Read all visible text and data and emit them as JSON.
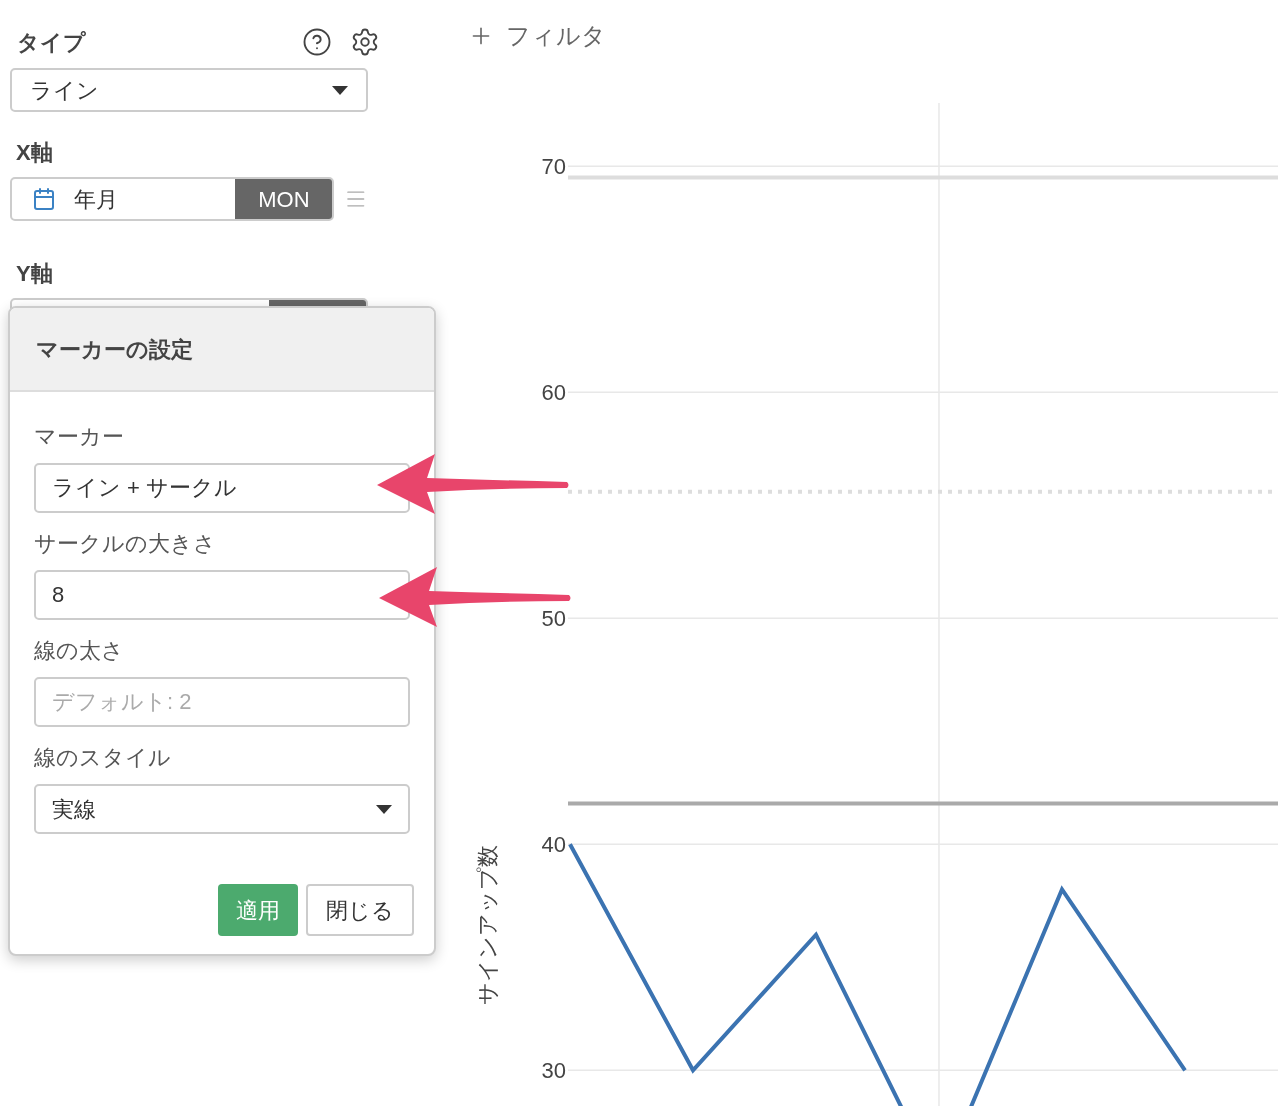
{
  "sidebar": {
    "type_label": "タイプ",
    "type_select": "ライン",
    "x_axis_label": "X軸",
    "x_field": {
      "value": "年月",
      "badge": "MON"
    },
    "y_axis_label": "Y軸"
  },
  "filter_button": "フィルタ",
  "marker_dialog": {
    "title": "マーカーの設定",
    "fields": [
      {
        "kind": "text",
        "label": "マーカー",
        "value": "ライン + サークル"
      },
      {
        "kind": "text",
        "label": "サークルの大きさ",
        "value": "8"
      },
      {
        "kind": "text",
        "label": "線の太さ",
        "placeholder": "デフォルト: 2"
      },
      {
        "kind": "select",
        "label": "線のスタイル",
        "value": "実線"
      }
    ],
    "buttons": [
      {
        "label": "適用",
        "kind": "primary"
      },
      {
        "label": "閉じる",
        "kind": "default"
      }
    ]
  },
  "chart": {
    "chart_data": {
      "type": "line",
      "ylabel": "サインアップ数",
      "categories": [
        null,
        null,
        null,
        null,
        null,
        null,
        null
      ],
      "ylim": [
        23,
        72.8
      ],
      "yticks": [
        30,
        40,
        50,
        60,
        70
      ],
      "grid": true,
      "ref_lines": [
        {
          "axis": "y",
          "value": 69.5,
          "color": "#dddddd"
        },
        {
          "axis": "y",
          "value": 55.6,
          "color": "#dddddd"
        },
        {
          "axis": "y",
          "value": 41.8,
          "color": "#aaaaaa"
        }
      ],
      "series": [
        {
          "color": "#3b73b1",
          "values": [
            40,
            30,
            36,
            25,
            38,
            30,
            null
          ]
        }
      ]
    }
  }
}
